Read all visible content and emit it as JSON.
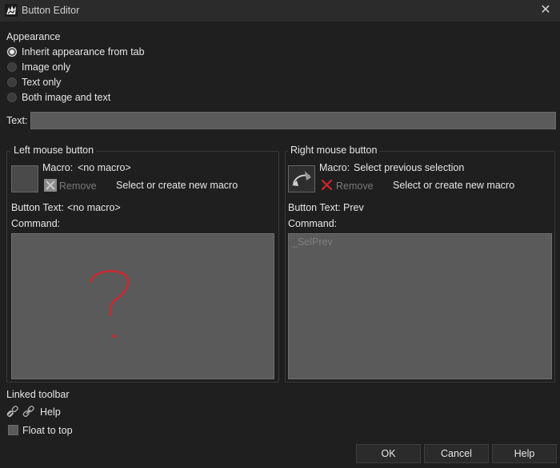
{
  "window": {
    "title": "Button Editor"
  },
  "appearance": {
    "heading": "Appearance",
    "options": [
      {
        "label": "Inherit appearance from tab",
        "checked": true
      },
      {
        "label": "Image only",
        "checked": false
      },
      {
        "label": "Text only",
        "checked": false
      },
      {
        "label": "Both image and text",
        "checked": false
      }
    ]
  },
  "text_field": {
    "label": "Text:",
    "value": ""
  },
  "left": {
    "heading": "Left mouse button",
    "macro_label": "Macro:",
    "macro_value": "<no macro>",
    "remove_label": "Remove",
    "select_label": "Select or create new macro",
    "button_text_label": "Button Text:",
    "button_text_value": "<no macro>",
    "command_label": "Command:",
    "command_value": "",
    "annotation": "?"
  },
  "right": {
    "heading": "Right mouse button",
    "macro_label": "Macro:",
    "macro_value": "Select previous selection",
    "remove_label": "Remove",
    "select_label": "Select or create new macro",
    "button_text_label": "Button Text:",
    "button_text_value": "Prev",
    "command_label": "Command:",
    "command_value": "_SelPrev"
  },
  "linked_toolbar": {
    "heading": "Linked toolbar",
    "help_label": "Help"
  },
  "float_to_top": {
    "label": "Float to top",
    "checked": false
  },
  "buttons": {
    "ok": "OK",
    "cancel": "Cancel",
    "help": "Help"
  },
  "colors": {
    "accent_red": "#d0262d",
    "background": "#1f1f1f",
    "field": "#5a5a5a"
  }
}
